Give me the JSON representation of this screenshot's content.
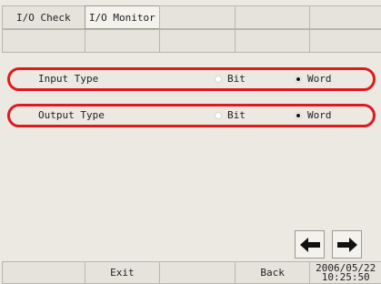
{
  "header": {
    "tabs": [
      {
        "label": "I/O Check"
      },
      {
        "label": "I/O Monitor"
      }
    ]
  },
  "options": {
    "input": {
      "label": "Input Type",
      "choices": [
        "Bit",
        "Word"
      ],
      "selected": "Word"
    },
    "output": {
      "label": "Output Type",
      "choices": [
        "Bit",
        "Word"
      ],
      "selected": "Word"
    }
  },
  "nav": {
    "left_icon": "arrow-left-icon",
    "right_icon": "arrow-right-icon"
  },
  "footer": {
    "exit_label": "Exit",
    "back_label": "Back",
    "date": "2006/05/22",
    "time": "10:25:50"
  },
  "colors": {
    "highlight": "#e0191f",
    "background": "#ece9e2"
  }
}
